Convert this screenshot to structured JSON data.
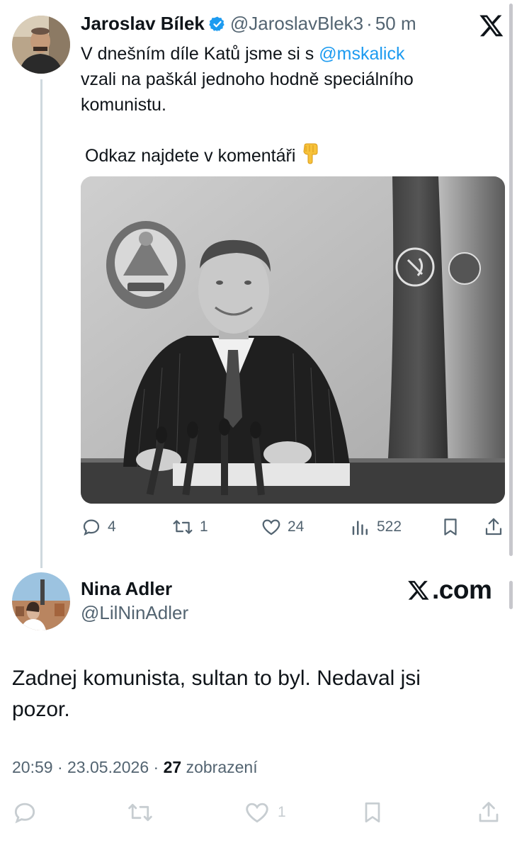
{
  "tweet": {
    "author_name": "Jaroslav Bílek",
    "author_handle": "@JaroslavBlek3",
    "separator": "·",
    "time": "50 m",
    "text_before_mention": "V dnešním díle Katů jsme si s ",
    "mention": "@mskalick",
    "text_after_mention": "vzali na paškál jednoho hodně speciálního komunistu.",
    "text_para2": "Odkaz najdete v komentáři",
    "emoji_icon": "backhand-index-pointing-down-icon",
    "media_alt": "Black and white photograph of a smiling man in a pinstripe suit seated at a desk with microphones, state emblem on wall and flags behind",
    "actions": {
      "replies": "4",
      "reposts": "1",
      "likes": "24",
      "views": "522"
    }
  },
  "reply": {
    "author_name": "Nina Adler",
    "author_handle": "@LilNinAdler",
    "text": "Zadnej komunista, sultan to byl. Nedaval jsi pozor.",
    "watermark": "com",
    "time": "20:59",
    "separator": "·",
    "date": "23.05.2026",
    "views_count": "27",
    "views_label": "zobrazení",
    "likes": "1"
  },
  "colors": {
    "accent": "#1d9bf0",
    "text": "#0f1419",
    "secondary": "#536471",
    "thread_line": "#cfd9de",
    "verified": "#1d9bf0"
  }
}
